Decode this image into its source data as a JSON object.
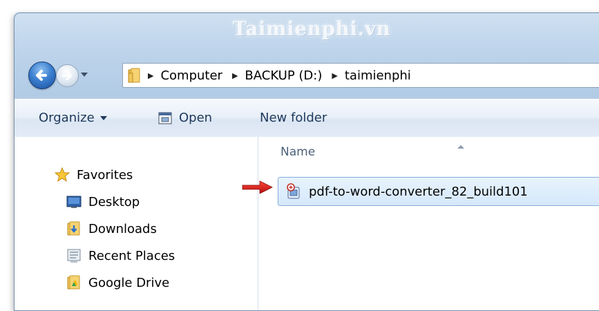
{
  "window": {
    "title": "Taimienphi.vn"
  },
  "navigation": {
    "breadcrumb": [
      "Computer",
      "BACKUP (D:)",
      "taimienphi"
    ]
  },
  "toolbar": {
    "organize_label": "Organize",
    "open_label": "Open",
    "new_folder_label": "New folder"
  },
  "sidebar": {
    "items": [
      {
        "label": "Favorites",
        "icon": "star-icon"
      },
      {
        "label": "Desktop",
        "icon": "desktop-icon"
      },
      {
        "label": "Downloads",
        "icon": "downloads-folder-icon"
      },
      {
        "label": "Recent Places",
        "icon": "recent-places-icon"
      },
      {
        "label": "Google Drive",
        "icon": "google-drive-folder-icon"
      }
    ]
  },
  "file_list": {
    "column_name": "Name",
    "files": [
      {
        "name": "pdf-to-word-converter_82_build101",
        "icon": "installer-icon",
        "selected": true
      }
    ]
  },
  "colors": {
    "accent": "#3b7fd0",
    "selection": "#d5e8fb",
    "annotation_arrow": "#e01818"
  }
}
